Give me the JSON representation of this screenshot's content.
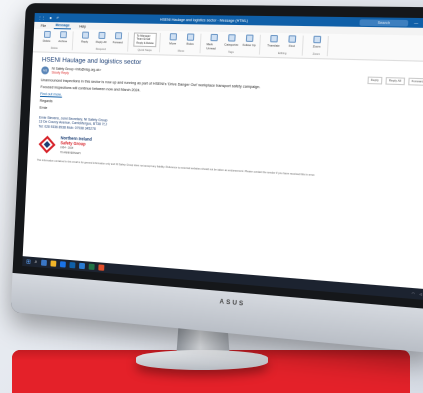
{
  "titlebar": {
    "window_title": "HSENI Haulage and logistics sector - Message (HTML)",
    "search_placeholder": "Search"
  },
  "menu_tabs": [
    "File",
    "Message",
    "Help"
  ],
  "ribbon": {
    "delete_group": {
      "label": "Delete",
      "buttons": [
        "Delete",
        "Archive"
      ]
    },
    "respond_group": {
      "label": "Respond",
      "buttons": [
        "Reply",
        "Reply All",
        "Forward"
      ]
    },
    "quick_steps": {
      "label": "Quick Steps",
      "items": [
        "To Manager",
        "Team Email",
        "Reply & Delete"
      ]
    },
    "move_group": {
      "label": "Move",
      "buttons": [
        "Move",
        "Rules"
      ]
    },
    "tags_group": {
      "label": "Tags",
      "buttons": [
        "Mark Unread",
        "Categorize",
        "Follow Up"
      ]
    },
    "editing_group": {
      "label": "Editing",
      "buttons": [
        "Translate",
        "Find"
      ]
    },
    "zoom_group": {
      "label": "Zoom",
      "buttons": [
        "Zoom"
      ]
    }
  },
  "message": {
    "subject": "HSENI Haulage and logistics sector",
    "avatar_initials": "NS",
    "sender": "NI Safety Group <info@nisg.org.uk>",
    "sent_flag": "Slowly Reply",
    "actions": [
      "Reply",
      "Reply All",
      "Forward"
    ],
    "body": [
      "Unannounced inspections in this sector is now up and running as part of HSENI's 'Drive Danger Out' workplace transport safety campaign.",
      "Focused inspections will continue between now and March 2024."
    ],
    "link": "Find out more.",
    "regards": "Regards",
    "signoff": "Ernie",
    "signature": [
      "Ernie Stevens, Joint Secretary, NI Safety Group",
      "13 De Courcy Avenue, Carrickfergus, BT38 7LJ",
      "Tel: 028 9336 8938 Mob: 07938 345278"
    ]
  },
  "logo": {
    "line1": "Northern Ireland",
    "line2": "Safety Group",
    "years": "1954 - 2024",
    "anniversary": "70 ANNIVERSARY"
  },
  "disclaimer": "This information contained in this email is for general information only and NI Safety Group does not accept any liability. Reference to external websites should not be taken as endorsement. Please contact the sender if you have received this in error.",
  "monitor_brand": "ASUS",
  "colors": {
    "accent": "#0f5fa8",
    "banner": "#e42129",
    "logo_red": "#d62128"
  }
}
